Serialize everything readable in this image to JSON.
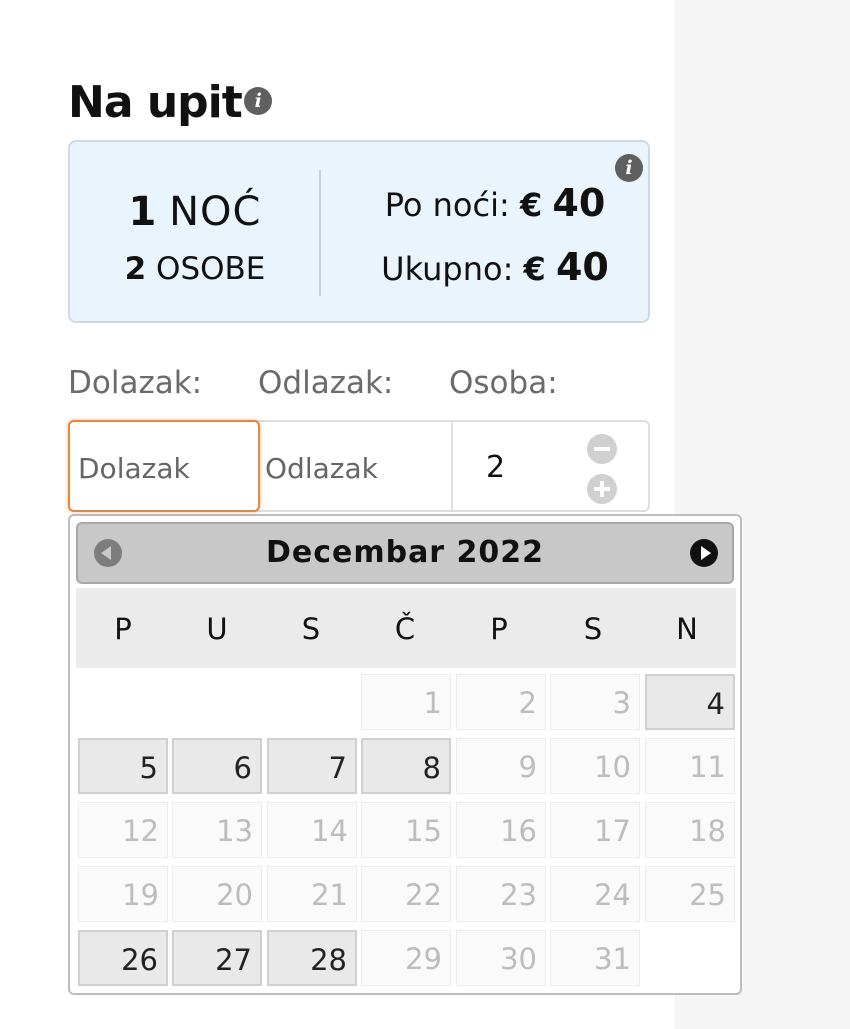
{
  "title": "Na upit",
  "summary": {
    "nights_count": "1",
    "nights_label": "NOĆ",
    "persons_count": "2",
    "persons_label": "OSOBE",
    "per_night_label": "Po noći:",
    "per_night_currency": "€",
    "per_night_amount": "40",
    "total_label": "Ukupno:",
    "total_currency": "€",
    "total_amount": "40"
  },
  "form": {
    "arrival_label": "Dolazak:",
    "departure_label": "Odlazak:",
    "persons_label": "Osoba:",
    "arrival_placeholder": "Dolazak",
    "departure_placeholder": "Odlazak",
    "persons_value": "2"
  },
  "calendar": {
    "month_title": "Decembar 2022",
    "weekdays": [
      "P",
      "U",
      "S",
      "Č",
      "P",
      "S",
      "N"
    ],
    "first_weekday_index": 3,
    "days_in_month": 31,
    "available_days": [
      4,
      5,
      6,
      7,
      8,
      26,
      27,
      28
    ]
  },
  "colors": {
    "accent": "#e8863a",
    "summary_bg": "#eaf4fd",
    "header_bg": "#c8c8c8"
  }
}
